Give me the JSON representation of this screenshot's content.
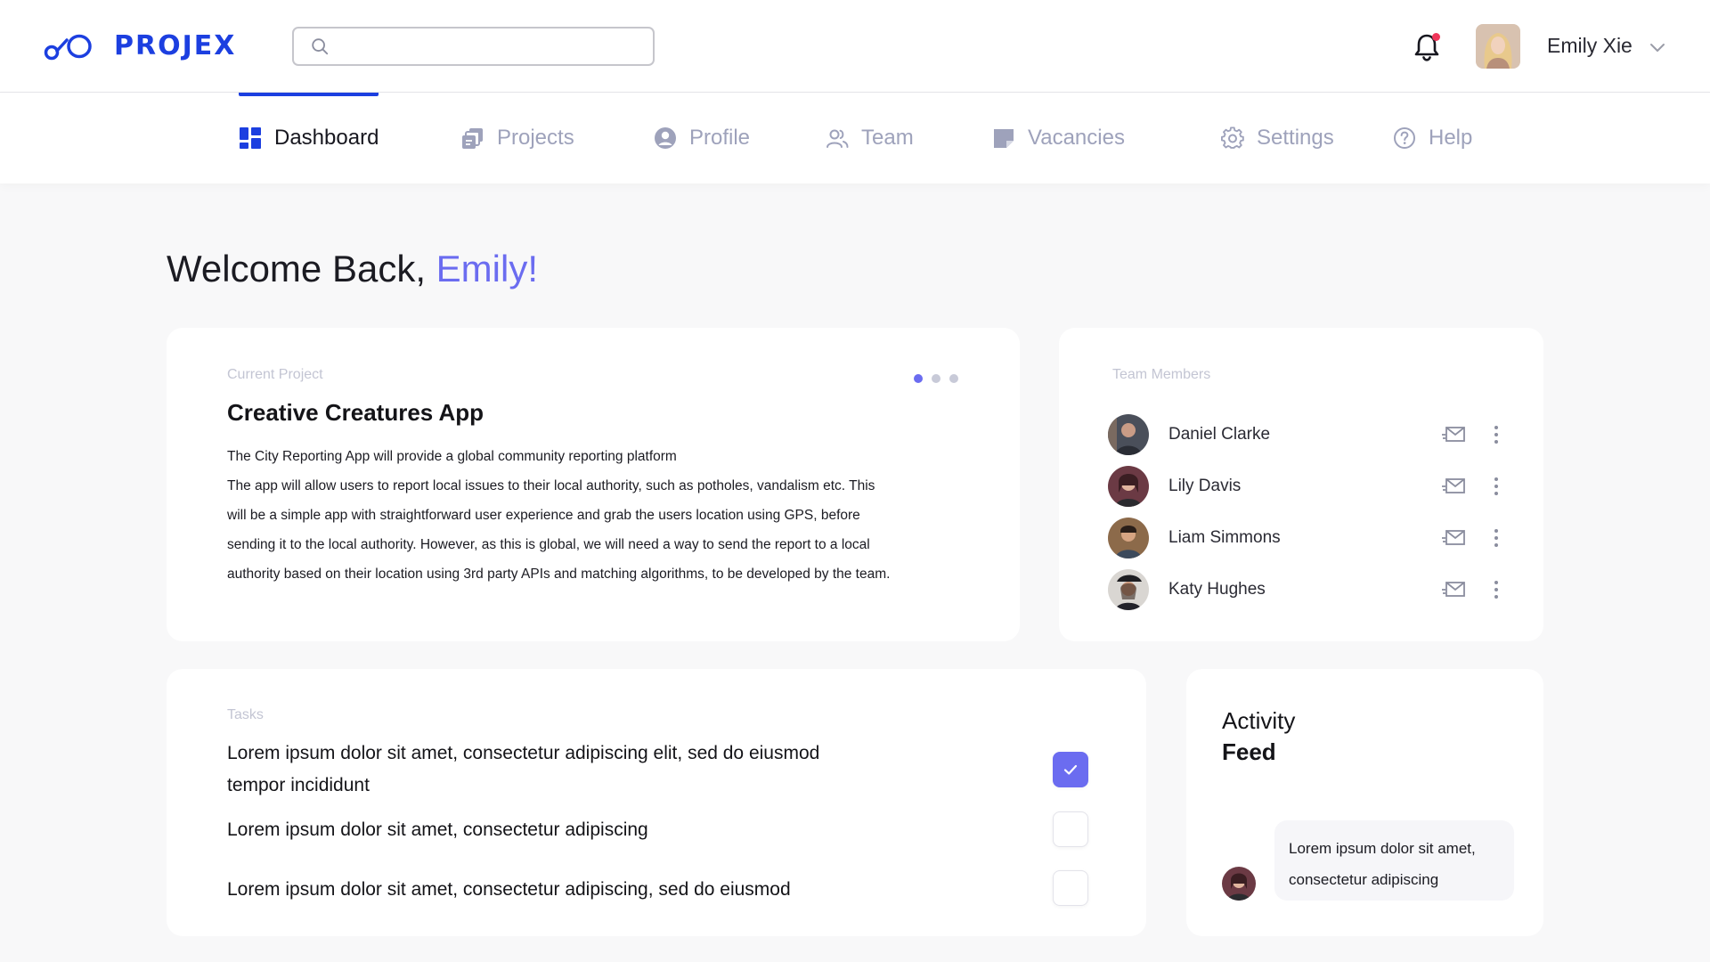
{
  "brand": {
    "name": "PROJEX",
    "color": "#1c3fe0"
  },
  "search": {
    "placeholder": "",
    "value": ""
  },
  "user": {
    "name": "Emily Xie",
    "has_notification": true
  },
  "nav": {
    "items": [
      {
        "label": "Dashboard",
        "icon": "dashboard-icon",
        "active": true
      },
      {
        "label": "Projects",
        "icon": "projects-icon",
        "active": false
      },
      {
        "label": "Profile",
        "icon": "profile-icon",
        "active": false
      },
      {
        "label": "Team",
        "icon": "team-icon",
        "active": false
      },
      {
        "label": "Vacancies",
        "icon": "vacancies-icon",
        "active": false
      },
      {
        "label": "Settings",
        "icon": "gear-icon",
        "active": false
      },
      {
        "label": "Help",
        "icon": "help-icon",
        "active": false
      }
    ]
  },
  "welcome": {
    "greeting": "Welcome Back,",
    "name": "Emily!"
  },
  "project": {
    "label": "Current Project",
    "title": "Creative Creatures App",
    "description_lines": [
      "The City Reporting App will provide a global community reporting platform",
      "The app will allow users to report local issues to their local authority, such as potholes, vandalism etc. This",
      "will be a simple app with straightforward user experience and grab the users location using GPS, before",
      "sending it to the local authority. However, as this is global, we will need a way to send the report to a local",
      "authority based on their location using 3rd party APIs and matching algorithms, to be developed by the team."
    ],
    "carousel": {
      "count": 3,
      "active_index": 0
    }
  },
  "team": {
    "label": "Team Members",
    "members": [
      {
        "name": "Daniel Clarke"
      },
      {
        "name": "Lily Davis"
      },
      {
        "name": "Liam Simmons"
      },
      {
        "name": "Katy Hughes"
      }
    ]
  },
  "tasks": {
    "label": "Tasks",
    "items": [
      {
        "text": "Lorem ipsum dolor sit amet, consectetur adipiscing elit, sed do eiusmod tempor incididunt",
        "done": true
      },
      {
        "text": "Lorem ipsum dolor sit amet, consectetur adipiscing",
        "done": false
      },
      {
        "text": "Lorem ipsum dolor sit amet, consectetur adipiscing, sed do eiusmod",
        "done": false
      }
    ]
  },
  "activity": {
    "title_line1": "Activity",
    "title_line2": "Feed",
    "message": "Lorem ipsum dolor sit amet, consectetur adipiscing"
  },
  "colors": {
    "accent": "#6b6cf0",
    "nav_inactive": "#9ea2bb",
    "notification": "#f0365a"
  }
}
